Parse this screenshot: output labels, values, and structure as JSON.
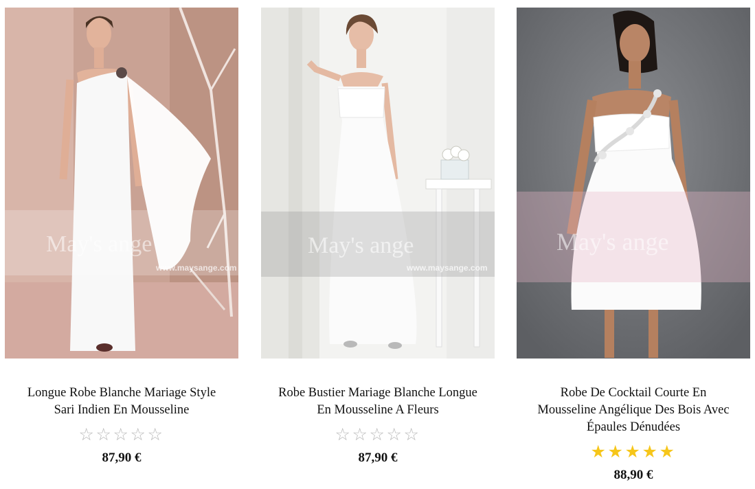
{
  "products": [
    {
      "title_line1": "Longue Robe Blanche Mariage Style",
      "title_line2": "Sari Indien En Mousseline",
      "rating": 0,
      "rating_max": 5,
      "price": "87,90 €",
      "watermark_brand": "May's ange",
      "watermark_url": "www.maysange.com",
      "background_color": "#cfa69a",
      "icon": "photo"
    },
    {
      "title_line1": "Robe Bustier Mariage Blanche Longue",
      "title_line2": "En Mousseline A Fleurs",
      "rating": 0,
      "rating_max": 5,
      "price": "87,90 €",
      "watermark_brand": "May's ange",
      "watermark_url": "www.maysange.com",
      "background_color": "#f1f1ef",
      "icon": "photo"
    },
    {
      "title_line1": "Robe De Cocktail Courte En",
      "title_line2": "Mousseline Angélique Des Bois Avec",
      "title_line3": "Épaules Dénudées",
      "rating": 5,
      "rating_max": 5,
      "price": "88,90 €",
      "watermark_brand": "May's ange",
      "background_color": "#75777b",
      "icon": "photo"
    }
  ],
  "colors": {
    "star_filled": "#f6c61a",
    "star_empty": "#b8b8b8"
  }
}
